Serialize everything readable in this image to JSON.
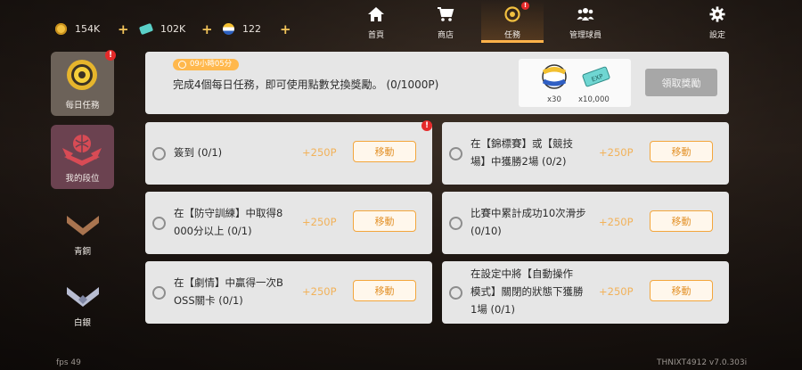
{
  "currencies": [
    {
      "icon": "coin-icon",
      "value": "154K"
    },
    {
      "icon": "ticket-icon",
      "value": "102K"
    },
    {
      "icon": "ball-icon",
      "value": "122"
    }
  ],
  "plus_symbol": "+",
  "nav": [
    {
      "icon": "home-icon",
      "label": "首頁"
    },
    {
      "icon": "cart-icon",
      "label": "商店"
    },
    {
      "icon": "mission-icon",
      "label": "任務",
      "active": true,
      "badge": "!"
    },
    {
      "icon": "team-icon",
      "label": "管理球員"
    },
    {
      "icon": "gear-icon",
      "label": "設定"
    }
  ],
  "sidebar": [
    {
      "icon": "daily-mission-icon",
      "label": "每日任務",
      "badge": "!"
    },
    {
      "icon": "rank-emblem-icon",
      "label": "我的段位"
    },
    {
      "icon": "bronze-rank-icon",
      "label": "青銅"
    },
    {
      "icon": "silver-rank-icon",
      "label": "白銀"
    }
  ],
  "summary": {
    "timer": "09小時05分",
    "text": "完成4個每日任務，即可使用點數兌換獎勵。 (0/1000P)",
    "rewards": [
      {
        "icon": "ball-icon",
        "qty": "x30"
      },
      {
        "icon": "exp-ticket-icon",
        "qty": "x10,000",
        "tag": "EXP"
      }
    ],
    "claim_label": "領取獎勵"
  },
  "tasks": [
    {
      "lines": [
        "簽到 (0/1)"
      ],
      "points": "+250P",
      "button": "移動",
      "badge": "!"
    },
    {
      "lines": [
        "在【錦標賽】或【競技",
        "場】中獲勝2場 (0/2)"
      ],
      "points": "+250P",
      "button": "移動"
    },
    {
      "lines": [
        "在【防守訓練】中取得8",
        "000分以上 (0/1)"
      ],
      "points": "+250P",
      "button": "移動"
    },
    {
      "lines": [
        "比賽中累計成功10次滑步",
        "(0/10)"
      ],
      "points": "+250P",
      "button": "移動"
    },
    {
      "lines": [
        "在【劇情】中贏得一次B",
        "OSS關卡 (0/1)"
      ],
      "points": "+250P",
      "button": "移動"
    },
    {
      "lines": [
        "在設定中將【自動操作",
        "模式】關閉的狀態下獲勝",
        "1場 (0/1)"
      ],
      "points": "+250P",
      "button": "移動"
    }
  ],
  "footer": {
    "fps": "fps 49",
    "version": "THNIXT4912  v7.0.303i"
  }
}
